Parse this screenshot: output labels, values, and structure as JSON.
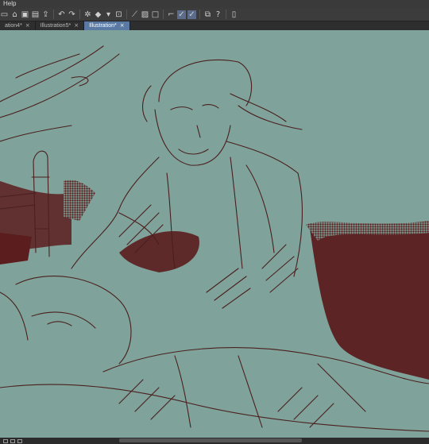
{
  "menubar": {
    "help_label": "Help"
  },
  "toolbar": {
    "icons": [
      "new-icon",
      "open-icon",
      "save-icon",
      "save-as-icon",
      "export-icon",
      "undo-icon",
      "redo-icon",
      "transform-icon",
      "fill-icon",
      "crop-icon",
      "selection-icon",
      "clear-icon",
      "brush-icon",
      "pen-icon",
      "pencil-icon",
      "layer-icon",
      "help-icon",
      "settings-icon"
    ]
  },
  "tabs": [
    {
      "label": "ation4*"
    },
    {
      "label": "Illustration5*"
    },
    {
      "label": "Illustration*"
    }
  ],
  "tab_close_glyph": "×",
  "colors": {
    "paper": "#7fa39a",
    "ink": "#4a1f1f",
    "shade": "#5b1d1d",
    "accent_tab": "#5b7aa3"
  }
}
